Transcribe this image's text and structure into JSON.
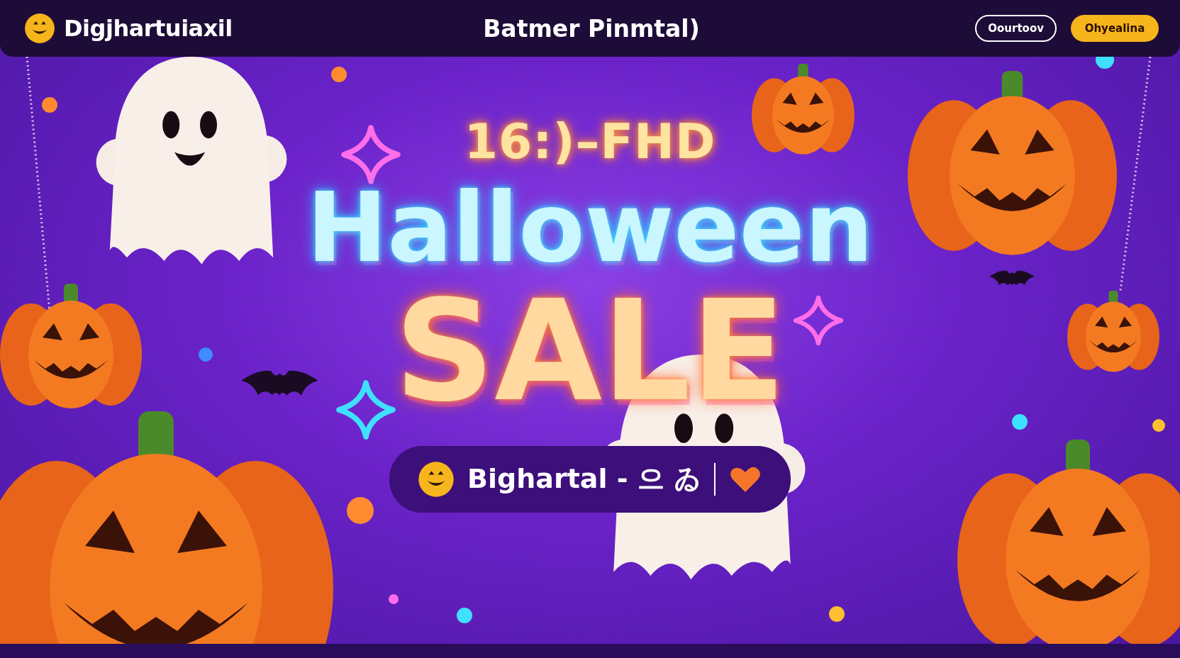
{
  "header": {
    "logo_text": "Digjhartuiaxil",
    "title": "Batmer Pinmtal)",
    "buttons": [
      {
        "label": "Oourtoov",
        "kind": "outline"
      },
      {
        "label": "Ohyealina",
        "kind": "filled"
      }
    ]
  },
  "banner": {
    "tagline": "16:)–FHD",
    "headline": "Halloween",
    "subheadline": "SALE",
    "pill": {
      "text": "Bighartal - 으 ゐ"
    }
  }
}
